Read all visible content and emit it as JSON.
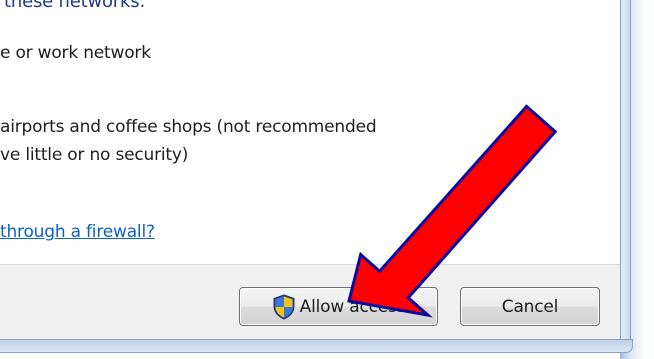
{
  "dialog": {
    "heading_partial": "these networks:",
    "option_home": "e or work network",
    "option_public_line1": "airports and coffee shops (not recommended",
    "option_public_line2": "ve little or no security)",
    "firewall_link": "through a firewall?",
    "buttons": {
      "allow_label": "Allow access",
      "cancel_label": "Cancel"
    }
  },
  "annotation": {
    "arrow_color": "#ff0000",
    "arrow_outline": "#0a0aa0",
    "arrow_points_to": "allow-access-button"
  },
  "icons": {
    "allow_button_icon": "uac-shield-icon"
  },
  "colors": {
    "link": "#0b63c7",
    "footer_bg": "#f0f0f0",
    "frame_accent": "#bcd0e8"
  }
}
